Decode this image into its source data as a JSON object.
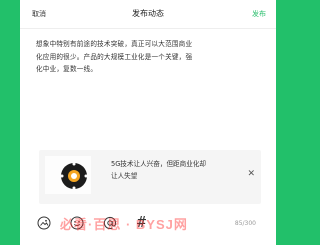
{
  "nav": {
    "cancel": "取消",
    "title": "发布动态",
    "publish": "发布"
  },
  "post": {
    "lines": [
      "想象中特别有前途的技术突破，真正可以大范围商业",
      "化应用的很少。产品的大规模工业化是一个关键，强",
      "化中业，复数一线。"
    ]
  },
  "share_card": {
    "title_lines": [
      "5G技术让人兴奋，但距商业化却",
      "让人失望"
    ],
    "close_icon": "close-icon",
    "thumb_icon": "5g-clock-logo-icon"
  },
  "toolbar": {
    "icons": [
      "image-icon",
      "emoji-icon",
      "at-icon",
      "hashtag-icon"
    ],
    "hash": "#",
    "counter": "85/300"
  },
  "watermark": "必看·百思 · BYSJ网",
  "colors": {
    "background": "#22c06a",
    "accent": "#2bbf6e"
  }
}
